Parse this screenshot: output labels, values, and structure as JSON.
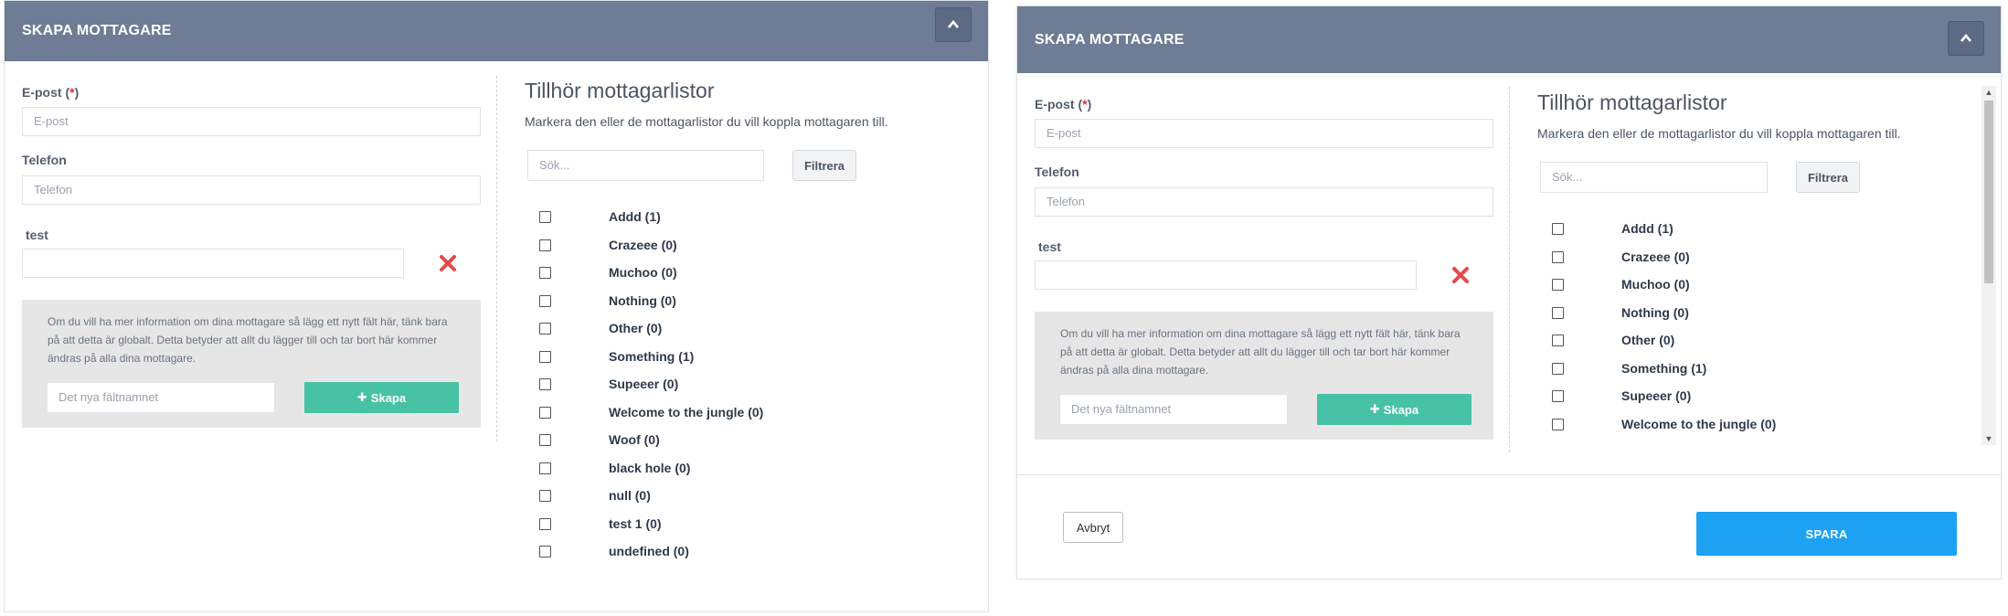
{
  "panels": [
    {
      "title": "SKAPA MOTTAGARE",
      "email_label": "E-post (",
      "email_req": "*",
      "email_close": ")",
      "email_placeholder": "E-post",
      "phone_label": "Telefon",
      "phone_placeholder": "Telefon",
      "custom_label": "test",
      "custom_value": "",
      "info_text": "Om du vill ha mer information om dina mottagare så lägg ett nytt fält här, tänk bara på att detta är globalt. Detta betyder att allt du lägger till och tar bort här kommer ändras på alla dina mottagare.",
      "new_field_placeholder": "Det nya fältnamnet",
      "create_label": "Skapa",
      "lists_title": "Tillhör mottagarlistor",
      "lists_subtitle": "Markera den eller de mottagarlistor du vill koppla mottagaren till.",
      "search_placeholder": "Sök...",
      "filter_label": "Filtrera",
      "lists": [
        "Addd (1)",
        "Crazeee (0)",
        "Muchoo (0)",
        "Nothing (0)",
        "Other (0)",
        "Something (1)",
        "Supeeer (0)",
        "Welcome to the jungle (0)",
        "Woof (0)",
        "black hole (0)",
        "null (0)",
        "test 1 (0)",
        "undefined (0)"
      ]
    },
    {
      "title": "SKAPA MOTTAGARE",
      "email_label": "E-post (",
      "email_req": "*",
      "email_close": ")",
      "email_placeholder": "E-post",
      "phone_label": "Telefon",
      "phone_placeholder": "Telefon",
      "custom_label": "test",
      "custom_value": "",
      "info_text": "Om du vill ha mer information om dina mottagare så lägg ett nytt fält här, tänk bara på att detta är globalt. Detta betyder att allt du lägger till och tar bort här kommer ändras på alla dina mottagare.",
      "new_field_placeholder": "Det nya fältnamnet",
      "create_label": "Skapa",
      "lists_title": "Tillhör mottagarlistor",
      "lists_subtitle": "Markera den eller de mottagarlistor du vill koppla mottagaren till.",
      "search_placeholder": "Sök...",
      "filter_label": "Filtrera",
      "lists": [
        "Addd (1)",
        "Crazeee (0)",
        "Muchoo (0)",
        "Nothing (0)",
        "Other (0)",
        "Something (1)",
        "Supeeer (0)",
        "Welcome to the jungle (0)"
      ],
      "cancel_label": "Avbryt",
      "save_label": "SPARA"
    }
  ],
  "colors": {
    "header": "#6e7c95",
    "create_button": "#48c2a5",
    "save_button": "#1da1f2",
    "required": "#e03131"
  }
}
